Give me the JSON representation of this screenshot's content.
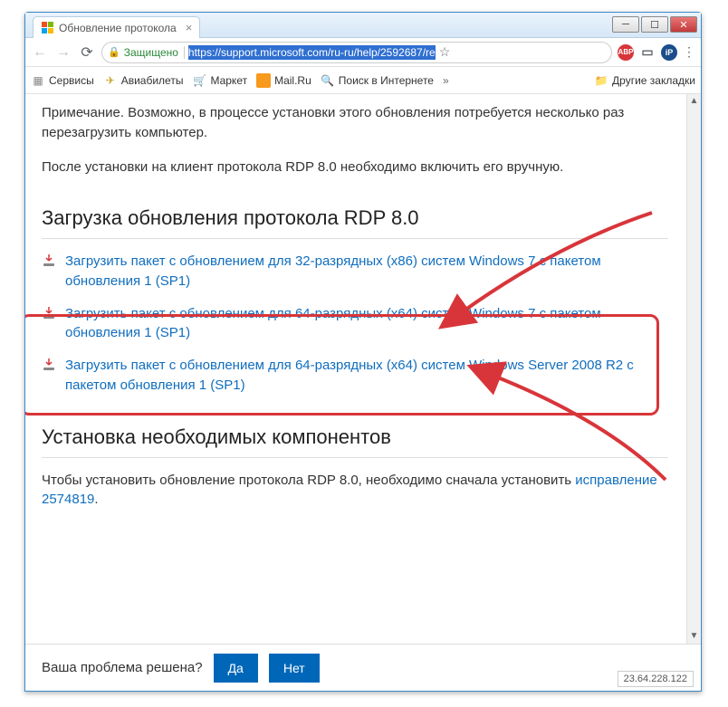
{
  "tab": {
    "title": "Обновление протокола"
  },
  "nav": {
    "secure_label": "Защищено",
    "url": "https://support.microsoft.com/ru-ru/help/2592687/re"
  },
  "bookmarks": {
    "services": "Сервисы",
    "flights": "Авиабилеты",
    "market": "Маркет",
    "mail": "Mail.Ru",
    "search": "Поиск в Интернете",
    "more": "»",
    "other": "Другие закладки"
  },
  "page": {
    "note": "Примечание. Возможно, в процессе установки этого обновления потребуется несколько раз перезагрузить компьютер.",
    "after_install": "После установки на клиент протокола RDP 8.0 необходимо включить его вручную.",
    "download_heading": "Загрузка обновления протокола RDP 8.0",
    "links": [
      "Загрузить пакет с обновлением для 32-разрядных (x86) систем Windows 7 с пакетом обновления 1 (SP1)",
      "Загрузить пакет с обновлением для 64-разрядных (x64) систем Windows 7 с пакетом обновления 1 (SP1)",
      "Загрузить пакет с обновлением для 64-разрядных (x64) систем Windows Server 2008 R2 с пакетом обновления 1 (SP1)"
    ],
    "install_heading": "Установка необходимых компонентов",
    "install_text_1": "Чтобы установить обновление протокола RDP 8.0, необходимо сначала установить ",
    "install_link": "исправление 2574819",
    "install_text_2": "."
  },
  "footer": {
    "question": "Ваша проблема решена?",
    "yes": "Да",
    "no": "Нет",
    "ip": "23.64.228.122"
  }
}
